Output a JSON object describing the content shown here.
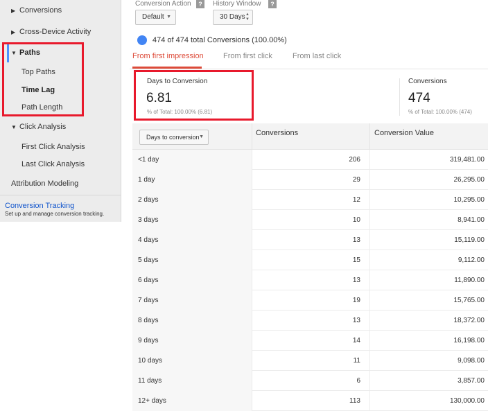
{
  "sidebar": {
    "items": [
      {
        "label": "Conversions",
        "arrow": "▶"
      },
      {
        "label": "Cross-Device Activity",
        "arrow": "▶"
      },
      {
        "label": "Paths",
        "arrow": "▼"
      },
      {
        "label": "Top Paths"
      },
      {
        "label": "Time Lag"
      },
      {
        "label": "Path Length"
      },
      {
        "label": "Click Analysis",
        "arrow": "▼"
      },
      {
        "label": "First Click Analysis"
      },
      {
        "label": "Last Click Analysis"
      },
      {
        "label": "Attribution Modeling"
      }
    ],
    "conversion_tracking": {
      "title": "Conversion Tracking",
      "description": "Set up and manage conversion tracking."
    }
  },
  "controls": {
    "conversion_action": {
      "label": "Conversion Action",
      "value": "Default",
      "help": "?"
    },
    "history_window": {
      "label": "History Window",
      "value": "30 Days",
      "help": "?"
    }
  },
  "total": {
    "text": "474 of 474 total Conversions (100.00%)",
    "dot_color": "#4285f4"
  },
  "tabs": [
    {
      "label": "From first impression",
      "active": true
    },
    {
      "label": "From first click"
    },
    {
      "label": "From last click"
    }
  ],
  "scorecards": [
    {
      "label": "Days to Conversion",
      "value": "6.81",
      "sub": "% of Total: 100.00% (6.81)"
    },
    {
      "label": "Conversions",
      "value": "474",
      "sub": "% of Total: 100.00% (474)"
    }
  ],
  "table": {
    "dimension_select": "Days to conversion",
    "headers": [
      "Conversions",
      "Conversion Value"
    ],
    "rows": [
      {
        "label": "<1 day",
        "conversions": "206",
        "value": "319,481.00"
      },
      {
        "label": "1 day",
        "conversions": "29",
        "value": "26,295.00"
      },
      {
        "label": "2 days",
        "conversions": "12",
        "value": "10,295.00"
      },
      {
        "label": "3 days",
        "conversions": "10",
        "value": "8,941.00"
      },
      {
        "label": "4 days",
        "conversions": "13",
        "value": "15,119.00"
      },
      {
        "label": "5 days",
        "conversions": "15",
        "value": "9,112.00"
      },
      {
        "label": "6 days",
        "conversions": "13",
        "value": "11,890.00"
      },
      {
        "label": "7 days",
        "conversions": "19",
        "value": "15,765.00"
      },
      {
        "label": "8 days",
        "conversions": "13",
        "value": "18,372.00"
      },
      {
        "label": "9 days",
        "conversions": "14",
        "value": "16,198.00"
      },
      {
        "label": "10 days",
        "conversions": "11",
        "value": "9,098.00"
      },
      {
        "label": "11 days",
        "conversions": "6",
        "value": "3,857.00"
      },
      {
        "label": "12+ days",
        "conversions": "113",
        "value": "130,000.00"
      }
    ]
  },
  "colors": {
    "accent_tab": "#dd4b39",
    "highlight_box": "#e8192c",
    "link": "#1155cc",
    "selected_bar": "#4d90fe"
  }
}
